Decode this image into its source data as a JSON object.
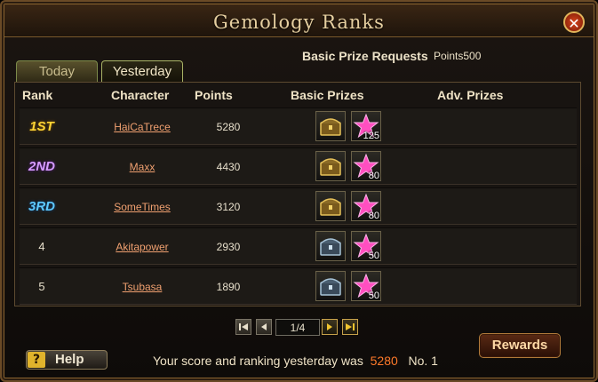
{
  "window": {
    "title": "Gemology Ranks",
    "close_icon": "close-icon"
  },
  "tabs": [
    {
      "label": "Today",
      "active": false
    },
    {
      "label": "Yesterday",
      "active": true
    }
  ],
  "prize_request": {
    "label": "Basic Prize Requests",
    "points": "Points500"
  },
  "table": {
    "headers": [
      "Rank",
      "Character",
      "Points",
      "Basic Prizes",
      "Adv. Prizes"
    ],
    "rows": [
      {
        "rank": "1ST",
        "character": "HaiCaTrece",
        "points": "5280",
        "chest": "gold-chest",
        "gem_qty": "125"
      },
      {
        "rank": "2ND",
        "character": "Maxx",
        "points": "4430",
        "chest": "gold-chest",
        "gem_qty": "80"
      },
      {
        "rank": "3RD",
        "character": "SomeTimes",
        "points": "3120",
        "chest": "gold-chest",
        "gem_qty": "80"
      },
      {
        "rank": "4",
        "character": "Akitapower",
        "points": "2930",
        "chest": "silver-chest",
        "gem_qty": "50"
      },
      {
        "rank": "5",
        "character": "Tsubasa",
        "points": "1890",
        "chest": "silver-chest",
        "gem_qty": "50"
      }
    ]
  },
  "pager": {
    "page": "1/4"
  },
  "help": {
    "icon": "?",
    "label": "Help"
  },
  "status": {
    "text": "Your score and ranking yesterday was",
    "score": "5280",
    "rank": "No. 1"
  },
  "rewards": {
    "label": "Rewards"
  },
  "colors": {
    "accent": "#e6cfa0",
    "link": "#f0a070",
    "first": "#ffd535",
    "second": "#d69cff",
    "third": "#5ec9ff",
    "score": "#ff7a2a"
  }
}
